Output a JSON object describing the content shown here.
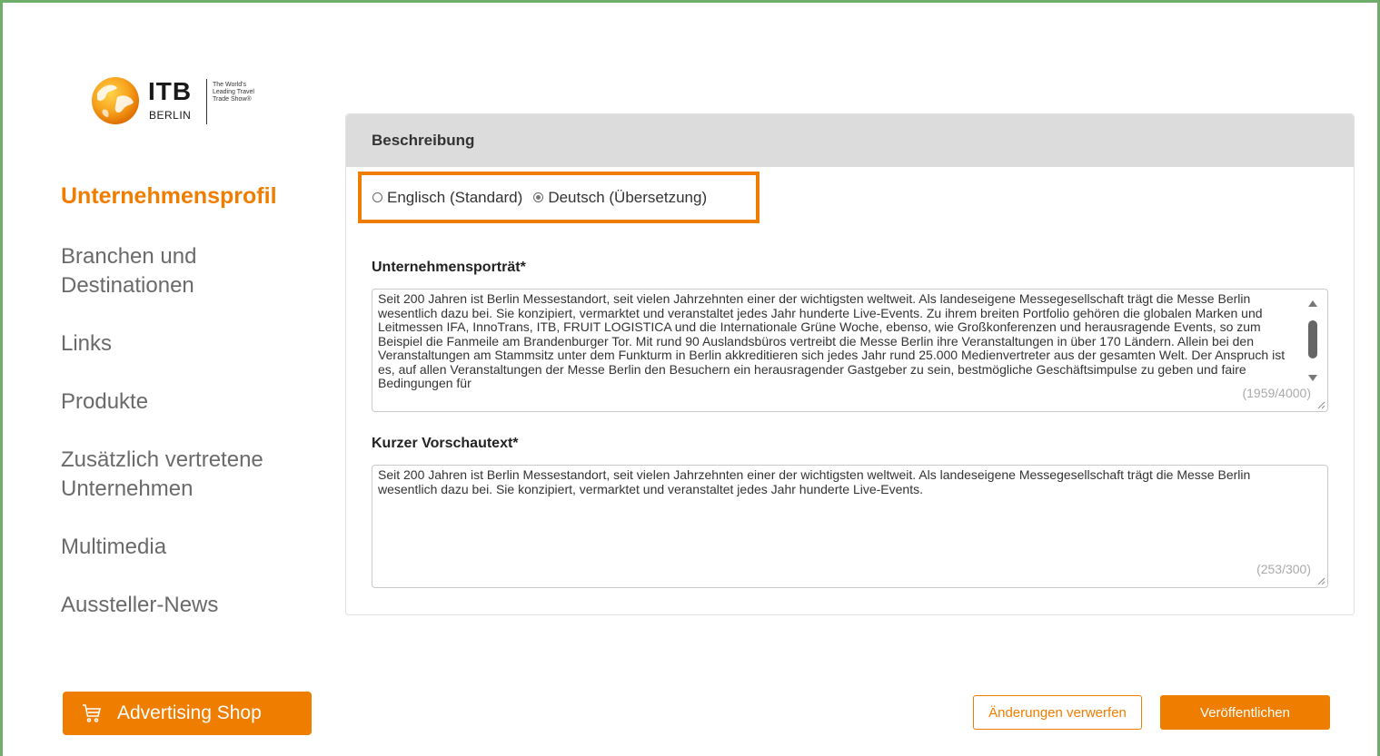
{
  "logo": {
    "brand": "ITB",
    "city": "BERLIN",
    "tagline": "The World's Leading Travel Trade Show®"
  },
  "sidebar": {
    "items": [
      {
        "label": "Unternehmensprofil",
        "active": true
      },
      {
        "label": "Branchen und Destinationen",
        "active": false
      },
      {
        "label": "Links",
        "active": false
      },
      {
        "label": "Produkte",
        "active": false
      },
      {
        "label": "Zusätzlich vertretene Unternehmen",
        "active": false
      },
      {
        "label": "Multimedia",
        "active": false
      },
      {
        "label": "Aussteller-News",
        "active": false
      }
    ],
    "shop_label": "Advertising Shop"
  },
  "panel": {
    "title": "Beschreibung",
    "languages": [
      {
        "label": "Englisch (Standard)",
        "selected": false
      },
      {
        "label": "Deutsch (Übersetzung)",
        "selected": true
      }
    ],
    "portrait": {
      "label": "Unternehmensporträt*",
      "text": "Seit 200 Jahren ist Berlin Messestandort, seit vielen Jahrzehnten einer der wichtigsten weltweit. Als landeseigene Messegesellschaft trägt die Messe Berlin wesentlich dazu bei. Sie konzipiert, vermarktet und veranstaltet jedes Jahr hunderte Live-Events. Zu ihrem breiten Portfolio gehören die globalen Marken und Leitmessen IFA, InnoTrans, ITB, FRUIT LOGISTICA und die Internationale Grüne Woche, ebenso, wie Großkonferenzen und herausragende Events, so zum Beispiel die Fanmeile am Brandenburger Tor. Mit rund 90 Auslandsbüros vertreibt die Messe Berlin ihre Veranstaltungen in über 170 Ländern. Allein bei den Veranstaltungen am Stammsitz unter dem Funkturm in Berlin akkreditieren sich jedes Jahr rund 25.000 Medienvertreter aus der gesamten Welt. Der Anspruch ist es, auf allen Veranstaltungen der Messe Berlin den Besuchern ein herausragender Gastgeber zu sein, bestmögliche Geschäftsimpulse zu geben und faire Bedingungen für",
      "counter": "(1959/4000)"
    },
    "preview": {
      "label": "Kurzer Vorschautext*",
      "text": "Seit 200 Jahren ist Berlin Messestandort, seit vielen Jahrzehnten einer der wichtigsten weltweit. Als landeseigene Messegesellschaft trägt die Messe Berlin wesentlich dazu bei. Sie konzipiert, vermarktet und veranstaltet jedes Jahr hunderte Live-Events.",
      "counter": "(253/300)"
    }
  },
  "footer": {
    "discard_label": "Änderungen verwerfen",
    "publish_label": "Veröffentlichen"
  },
  "colors": {
    "accent": "#ef7d00",
    "frame": "#6fae6a",
    "header_bg": "#dcdcdc"
  }
}
